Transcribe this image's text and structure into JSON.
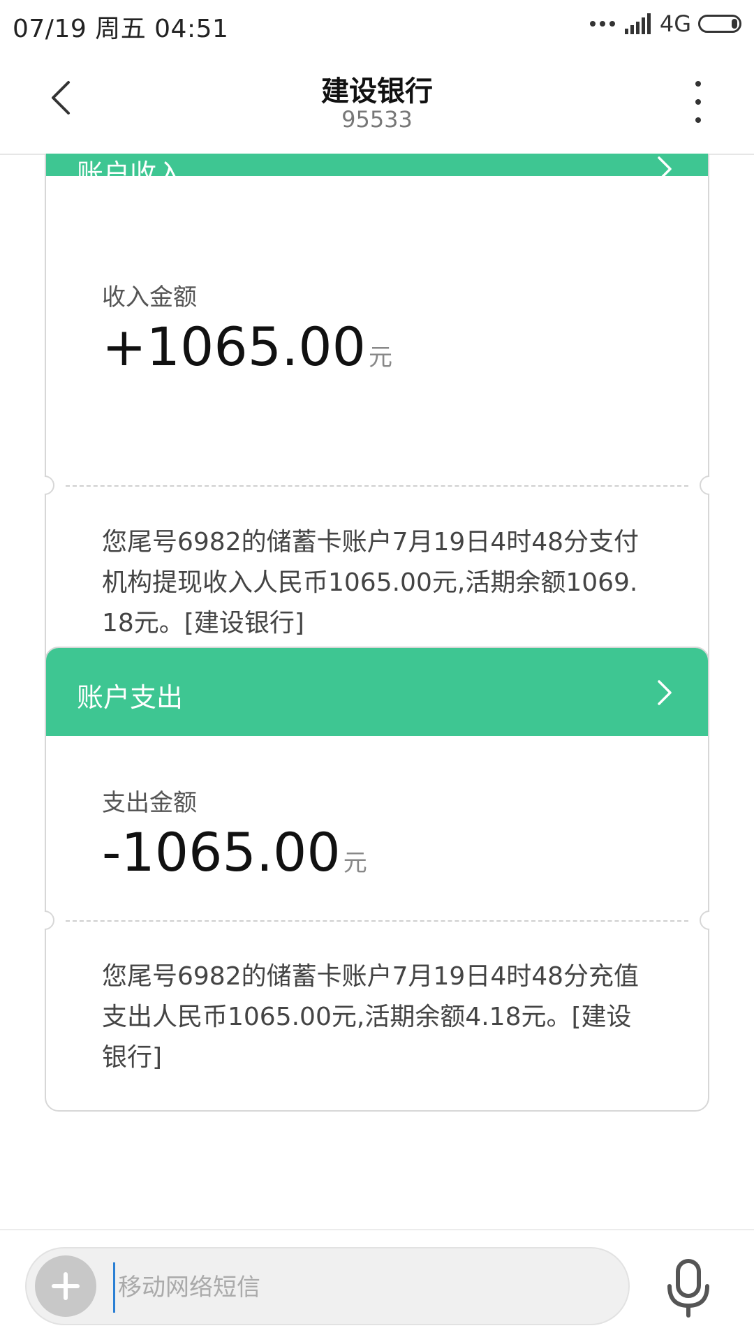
{
  "status_bar": {
    "time": "07/19  周五  04:51",
    "network": "4G"
  },
  "header": {
    "title": "建设银行",
    "subtitle": "95533"
  },
  "cards": [
    {
      "header_title": "账户收入",
      "amount_label": "收入金额",
      "amount_value": "+1065.00",
      "amount_unit": "元",
      "message": "您尾号6982的储蓄卡账户7月19日4时48分支付机构提现收入人民币1065.00元,活期余额1069.18元。[建设银行]"
    },
    {
      "header_title": "账户支出",
      "amount_label": "支出金额",
      "amount_value": "-1065.00",
      "amount_unit": "元",
      "message": "您尾号6982的储蓄卡账户7月19日4时48分充值支出人民币1065.00元,活期余额4.18元。[建设银行]"
    }
  ],
  "input_bar": {
    "placeholder": "移动网络短信"
  },
  "colors": {
    "card_header": "#3ec692"
  }
}
